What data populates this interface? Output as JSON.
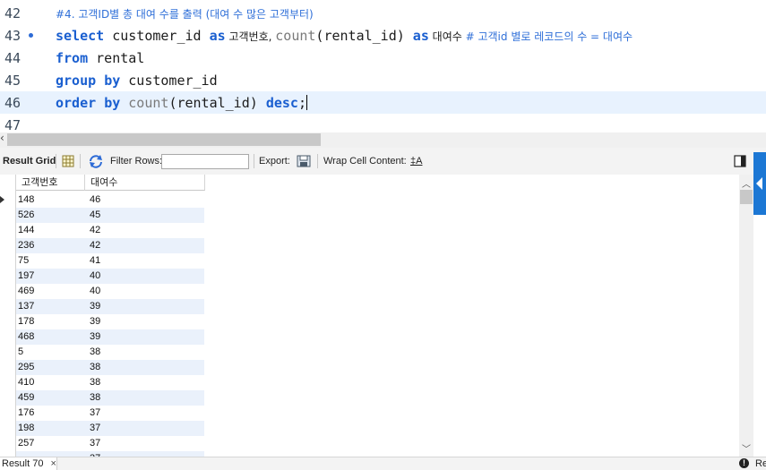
{
  "editor": {
    "lines": [
      {
        "num": "42",
        "comment": "#4. 고객ID별 총 대여 수를 출력 (대여 수 많은 고객부터)"
      },
      {
        "num": "43",
        "kw1": "select",
        "t1": " customer_id ",
        "kw2": "as",
        "t2": " 고객번호, ",
        "fn1": "count",
        "t3": "(rental_id) ",
        "kw3": "as",
        "t4": " 대여수 ",
        "comment": "# 고객id 별로 레코드의 수 = 대여수"
      },
      {
        "num": "44",
        "kw1": "from",
        "t1": " rental"
      },
      {
        "num": "45",
        "kw1": "group",
        "t1": " ",
        "kw2": "by",
        "t2": " customer_id"
      },
      {
        "num": "46",
        "kw1": "order",
        "t1": " ",
        "kw2": "by",
        "t2": " ",
        "fn1": "count",
        "t3": "(rental_id) ",
        "kw3": "desc",
        "t4": ";"
      },
      {
        "num": "47"
      }
    ]
  },
  "toolbar": {
    "result_grid": "Result Grid",
    "filter_rows": "Filter Rows:",
    "filter_value": "",
    "export": "Export:",
    "wrap_cell": "Wrap Cell Content:",
    "wrap_icon_text": "‡A"
  },
  "grid": {
    "columns": [
      "고객번호",
      "대여수"
    ],
    "rows": [
      [
        "148",
        "46"
      ],
      [
        "526",
        "45"
      ],
      [
        "144",
        "42"
      ],
      [
        "236",
        "42"
      ],
      [
        "75",
        "41"
      ],
      [
        "197",
        "40"
      ],
      [
        "469",
        "40"
      ],
      [
        "137",
        "39"
      ],
      [
        "178",
        "39"
      ],
      [
        "468",
        "39"
      ],
      [
        "5",
        "38"
      ],
      [
        "295",
        "38"
      ],
      [
        "410",
        "38"
      ],
      [
        "459",
        "38"
      ],
      [
        "176",
        "37"
      ],
      [
        "198",
        "37"
      ],
      [
        "257",
        "37"
      ],
      [
        "",
        "37"
      ]
    ]
  },
  "bottom": {
    "tab_label": "Result 70",
    "close": "×",
    "right_label": "Re"
  }
}
